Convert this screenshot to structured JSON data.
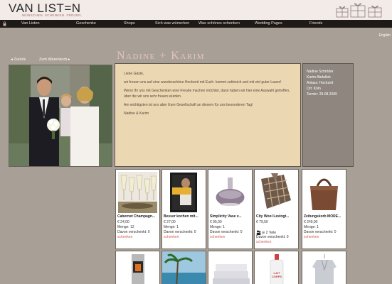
{
  "header": {
    "logo": "VAN LIST=N",
    "tagline": "WÜNSCHEN. SCHENKEN. FREUEN."
  },
  "nav": {
    "items": [
      "Van Listen",
      "Geschenke",
      "Shops",
      "Sich was wünschen",
      "Was schönes schenken",
      "Wedding Pages",
      "Friends"
    ]
  },
  "lang": "English",
  "subnav": {
    "back": "Zurück",
    "cart": "Zum Warenkorb"
  },
  "title": "Nadine + Karim",
  "letter": {
    "p1": "Liebe Gäste,",
    "p2": "wir freuen uns auf eine wunderschöne Hochzeit mit Euch. kommt zahlreich und mit viel guter Laune!",
    "p3": "Wenn Ihr uns mit Geschenken eine Freude machen möchtet, dann haben wir hier eine Auswahl getroffen, über die wir uns sehr freuen würden.",
    "p4": "Am wichtigsten ist uns aber Eure Gesellschaft an diesem für uns besonderen Tag!",
    "p5": "Nadine & Karim"
  },
  "info": {
    "line1": "Nadine Schröder",
    "line2": "Karim Abdallah",
    "line3": "Anlass: Hochzeit",
    "line4": "Ort: Köln",
    "line5": "Termin: 29.08.2009"
  },
  "products": [
    {
      "name": "Cabernet Champagn...",
      "price": "€ 24,00",
      "qty": "Menge: 12",
      "given": "Davon verschenkt: 0",
      "link": "schenken"
    },
    {
      "name": "Besser kochen mit...",
      "price": "€ 27,00",
      "qty": "Menge: 1",
      "given": "Davon verschenkt: 0",
      "link": "schenken",
      "book_text": "BESSER KOCHEN"
    },
    {
      "name": "Simplicity Vase v...",
      "price": "€ 95,00",
      "qty": "Menge: 1",
      "given": "Davon verschenkt: 0",
      "link": "schenken"
    },
    {
      "name": "City Wool Lexingt...",
      "price": "€ 79,50",
      "qty": "je 2 Teile",
      "given": "Davon verschenkt: 0",
      "link": "schenken"
    },
    {
      "name": "Zeitungskorb MORE...",
      "price": "€ 249,00",
      "qty": "Menge: 1",
      "given": "Davon verschenkt: 0",
      "link": "schenken"
    }
  ],
  "bottle_label": "LAIT CORPS"
}
